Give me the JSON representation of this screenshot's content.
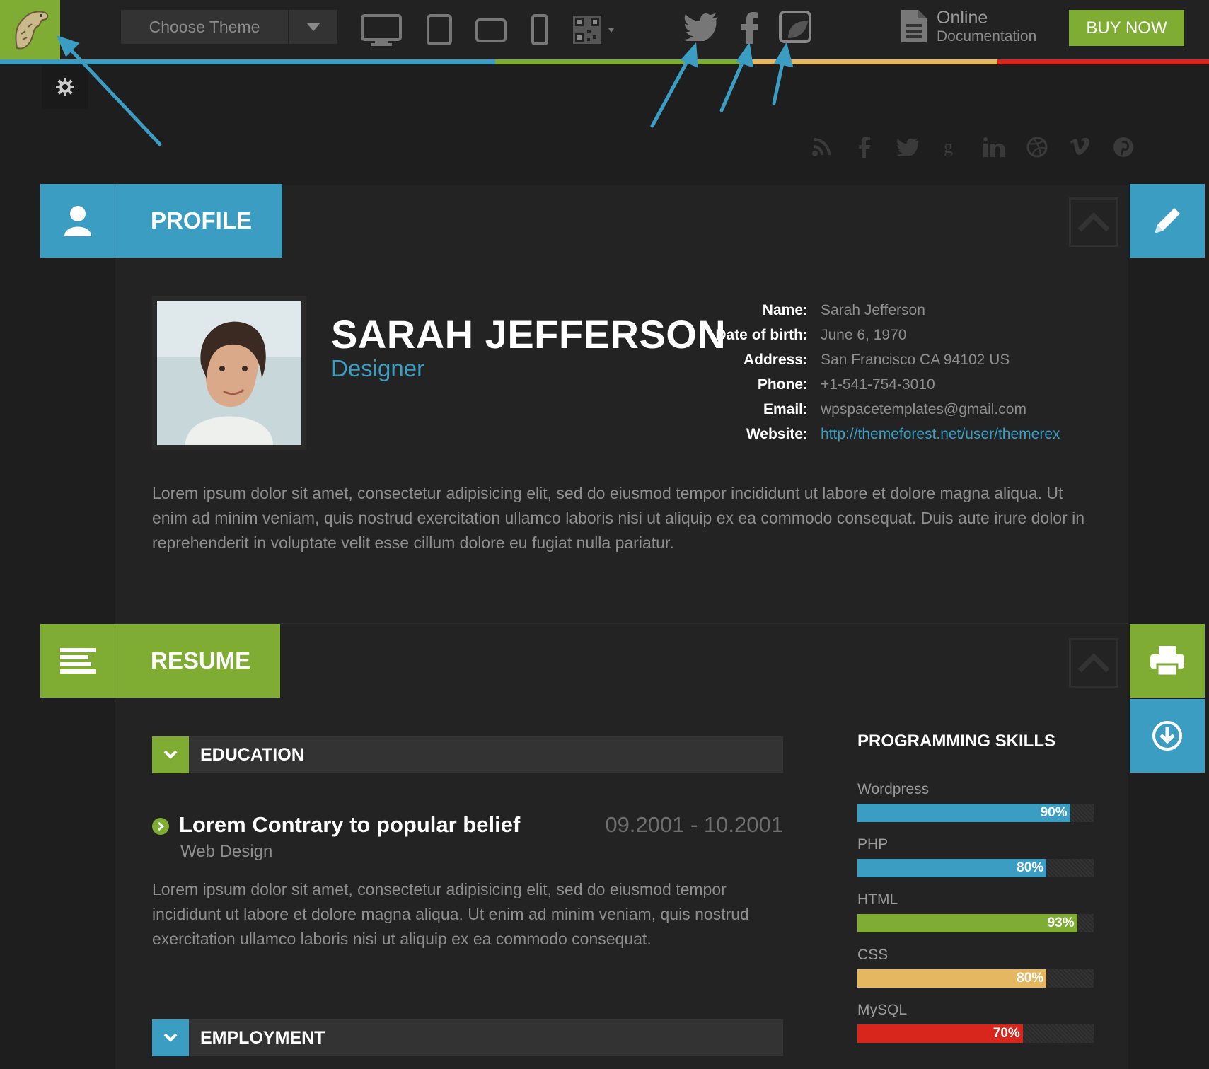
{
  "topbar": {
    "theme_select": "Choose Theme",
    "devices": [
      "desktop-icon",
      "tablet-icon",
      "tablet-landscape-icon",
      "phone-icon",
      "qr-code-icon"
    ],
    "social": [
      "twitter-icon",
      "facebook-icon",
      "share-icon"
    ],
    "docs_line1": "Online",
    "docs_line2": "Documentation",
    "buy_label": "BUY NOW"
  },
  "social_row": [
    "rss-icon",
    "facebook-icon",
    "twitter-icon",
    "google-plus-icon",
    "linkedin-icon",
    "dribbble-icon",
    "vimeo-icon",
    "pinterest-icon"
  ],
  "colors": {
    "green": "#7fad34",
    "blue": "#3b9dc2",
    "yellow": "#e5b761",
    "red": "#d9261c",
    "background": "#1e1e1e"
  },
  "profile": {
    "section_title": "PROFILE",
    "name": "SARAH JEFFERSON",
    "role": "Designer",
    "info": [
      {
        "label": "Name:",
        "value": "Sarah Jefferson"
      },
      {
        "label": "Date of birth:",
        "value": "June 6, 1970"
      },
      {
        "label": "Address:",
        "value": "San Francisco CA 94102 US"
      },
      {
        "label": "Phone:",
        "value": "+1-541-754-3010"
      },
      {
        "label": "Email:",
        "value": "wpspacetemplates@gmail.com"
      },
      {
        "label": "Website:",
        "value": "http://themeforest.net/user/themerex"
      }
    ],
    "bio": "Lorem ipsum dolor sit amet, consectetur adipisicing elit, sed do eiusmod tempor incididunt ut labore et dolore magna aliqua. Ut enim ad minim veniam, quis nostrud exercitation ullamco laboris nisi ut aliquip ex ea commodo consequat. Duis aute irure dolor in reprehenderit in voluptate velit esse cillum dolore eu fugiat nulla pariatur."
  },
  "resume": {
    "section_title": "RESUME",
    "education": {
      "heading": "EDUCATION",
      "item_title": "Lorem Contrary to popular belief",
      "item_date": "09.2001 - 10.2001",
      "item_sub": "Web Design",
      "item_desc": "Lorem ipsum dolor sit amet, consectetur adipisicing elit, sed do eiusmod tempor incididunt ut labore et dolore magna aliqua. Ut enim ad minim veniam, quis nostrud exercitation ullamco laboris nisi ut aliquip ex ea commodo consequat."
    },
    "employment": {
      "heading": "EMPLOYMENT"
    },
    "skills_title": "PROGRAMMING SKILLS",
    "skills": [
      {
        "name": "Wordpress",
        "percent": 90,
        "label": "90%",
        "color": "#3b9dc2"
      },
      {
        "name": "PHP",
        "percent": 80,
        "label": "80%",
        "color": "#3b9dc2"
      },
      {
        "name": "HTML",
        "percent": 93,
        "label": "93%",
        "color": "#7fad34"
      },
      {
        "name": "CSS",
        "percent": 80,
        "label": "80%",
        "color": "#e5b761"
      },
      {
        "name": "MySQL",
        "percent": 70,
        "label": "70%",
        "color": "#d9261c"
      }
    ]
  }
}
